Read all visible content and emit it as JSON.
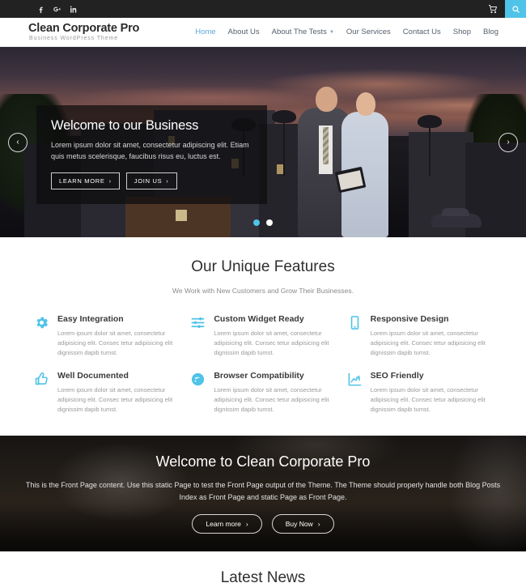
{
  "topbar": {
    "social": [
      {
        "name": "facebook-icon",
        "label": "Facebook"
      },
      {
        "name": "google-plus-icon",
        "label": "Google Plus"
      },
      {
        "name": "linkedin-icon",
        "label": "LinkedIn"
      }
    ],
    "cart_label": "Cart",
    "search_label": "Search",
    "accent_color": "#4fc3e8",
    "background_color": "#222222"
  },
  "header": {
    "brand_title": "Clean Corporate Pro",
    "brand_subtitle": "Business WordPress Theme",
    "nav": [
      {
        "label": "Home",
        "active": true,
        "has_caret": false
      },
      {
        "label": "About Us",
        "active": false,
        "has_caret": false
      },
      {
        "label": "About The Tests",
        "active": false,
        "has_caret": true
      },
      {
        "label": "Our Services",
        "active": false,
        "has_caret": false
      },
      {
        "label": "Contact Us",
        "active": false,
        "has_caret": false
      },
      {
        "label": "Shop",
        "active": false,
        "has_caret": false
      },
      {
        "label": "Blog",
        "active": false,
        "has_caret": false
      }
    ],
    "active_color": "#5ba7d8"
  },
  "hero": {
    "title": "Welcome to our Business",
    "description": "Lorem ipsum dolor sit amet, consectetur adipiscing elit. Etiam quis metus scelerisque, faucibus risus eu, luctus est.",
    "buttons": [
      {
        "label": "LEARN MORE",
        "arrow": "›"
      },
      {
        "label": "JOIN US",
        "arrow": "›"
      }
    ],
    "prev_arrow": "‹",
    "next_arrow": "›",
    "slides": [
      {
        "index": 1,
        "active": true
      },
      {
        "index": 2,
        "active": false
      }
    ],
    "active_dot_color": "#4fc3e8"
  },
  "features": {
    "title": "Our Unique Features",
    "subtitle": "We Work with New Customers and Grow Their Businesses.",
    "icon_color": "#4fc3e8",
    "items": [
      {
        "icon": "gear-icon",
        "heading": "Easy Integration",
        "text": "Lorem ipsum dolor sit amet, consectetur adipisicing elit. Consec tetur adipisicing elit dignissim dapib tumst."
      },
      {
        "icon": "sliders-icon",
        "heading": "Custom Widget Ready",
        "text": "Lorem ipsum dolor sit amet, consectetur adipisicing elit. Consec tetur adipisicing elit dignissim dapib tumst."
      },
      {
        "icon": "mobile-icon",
        "heading": "Responsive Design",
        "text": "Lorem ipsum dolor sit amet, consectetur adipisicing elit. Consec tetur adipisicing elit dignissim dapib tumst."
      },
      {
        "icon": "thumbs-up-icon",
        "heading": "Well Documented",
        "text": "Lorem ipsum dolor sit amet, consectetur adipisicing elit. Consec tetur adipisicing elit dignissim dapib tumst."
      },
      {
        "icon": "globe-icon",
        "heading": "Browser Compatibility",
        "text": "Lorem ipsum dolor sit amet, consectetur adipisicing elit. Consec tetur adipisicing elit dignissim dapib tumst."
      },
      {
        "icon": "chart-line-icon",
        "heading": "SEO Friendly",
        "text": "Lorem ipsum dolor sit amet, consectetur adipisicing elit. Consec tetur adipisicing elit dignissim dapib tumst."
      }
    ]
  },
  "cta": {
    "title": "Welcome to Clean Corporate Pro",
    "description": "This is the Front Page content. Use this static Page to test the Front Page output of the Theme. The Theme should properly handle both Blog Posts Index as Front Page and static Page as Front Page.",
    "buttons": [
      {
        "label": "Learn more",
        "arrow": "›"
      },
      {
        "label": "Buy Now",
        "arrow": "›"
      }
    ]
  },
  "news": {
    "title": "Latest News"
  }
}
